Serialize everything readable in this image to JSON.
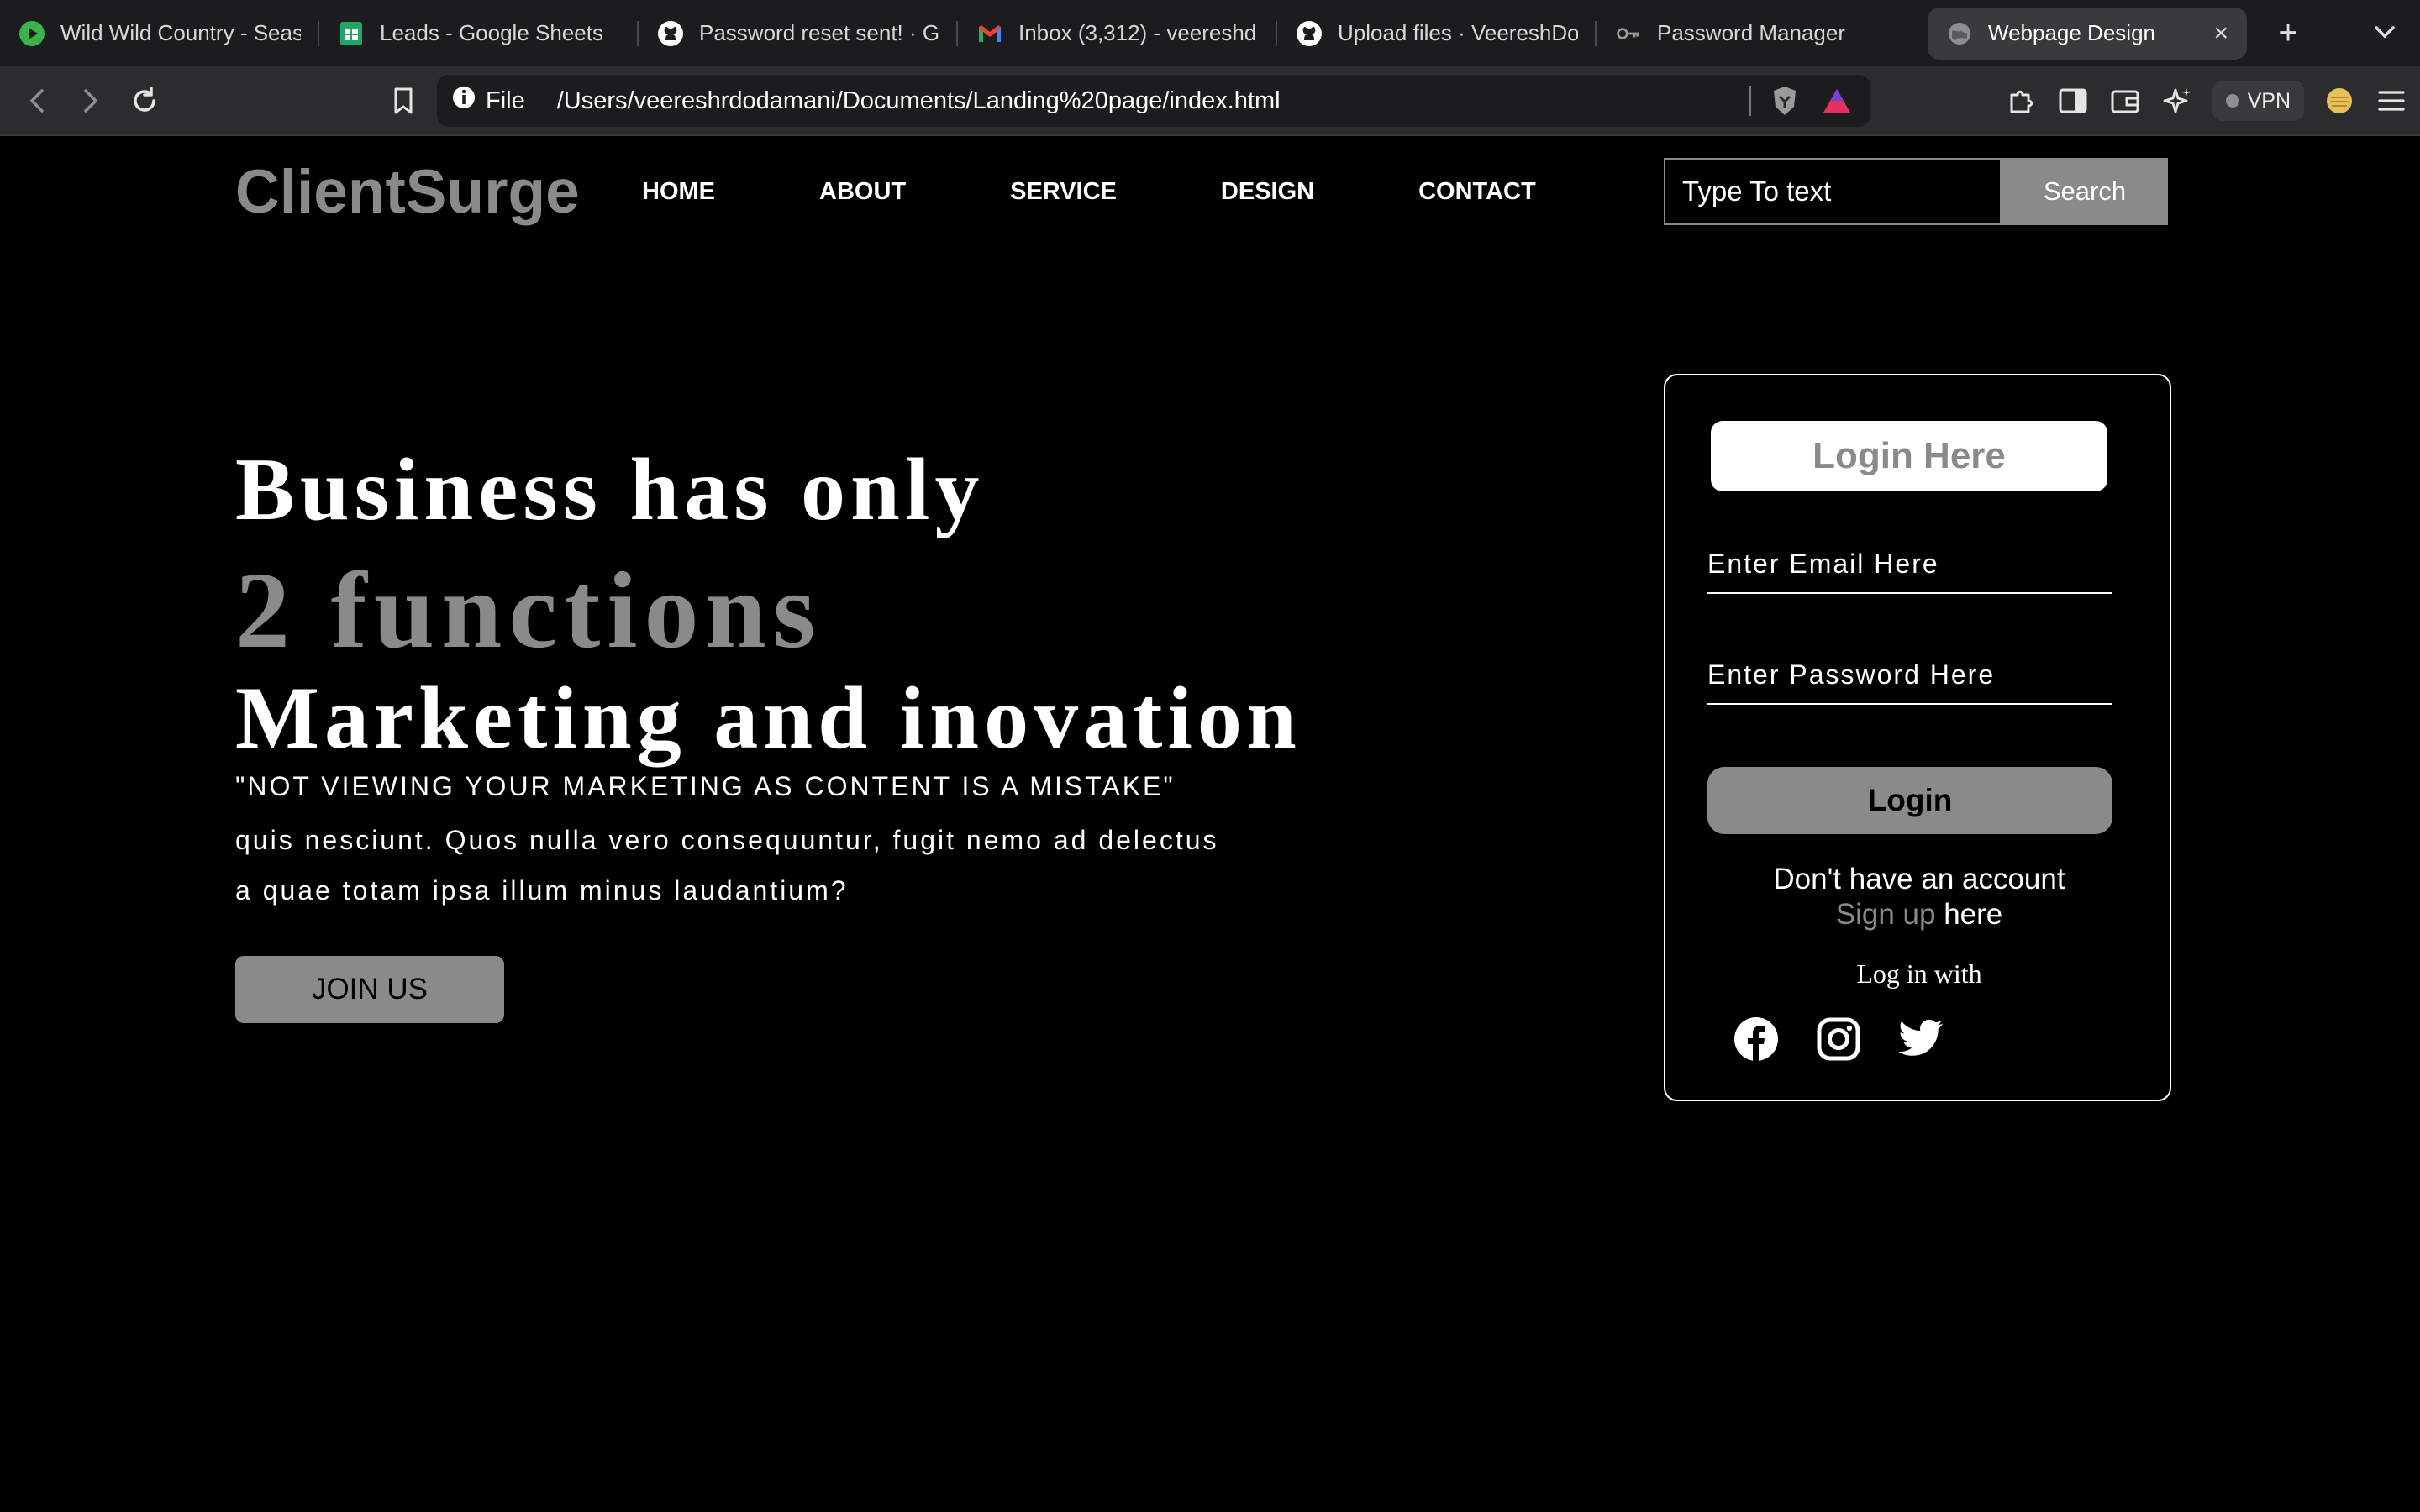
{
  "browser": {
    "tabs": [
      {
        "title": "Wild Wild Country - Seas",
        "icon": "play-icon"
      },
      {
        "title": "Leads - Google Sheets",
        "icon": "sheets-icon"
      },
      {
        "title": "Password reset sent! · Gi",
        "icon": "github-icon"
      },
      {
        "title": "Inbox (3,312) - veereshd",
        "icon": "gmail-icon"
      },
      {
        "title": "Upload files · VeereshDo",
        "icon": "github-icon"
      },
      {
        "title": "Password Manager",
        "icon": "key-icon"
      },
      {
        "title": "Webpage Design",
        "icon": "globe-icon",
        "active": true
      }
    ],
    "address": {
      "scheme_label": "File",
      "url": "/Users/veereshrdodamani/Documents/Landing%20page/index.html"
    },
    "vpn_label": "VPN"
  },
  "site": {
    "logo": "ClientSurge",
    "nav": [
      "HOME",
      "ABOUT",
      "SERVICE",
      "DESIGN",
      "CONTACT"
    ],
    "search": {
      "placeholder": "Type To text",
      "button": "Search"
    }
  },
  "hero": {
    "line1": "Business has only",
    "line2": "2 functions",
    "line3": "Marketing and inovation",
    "quote": "\"NOT VIEWING YOUR MARKETING AS CONTENT IS A MISTAKE\"",
    "desc_line1": "quis nesciunt. Quos nulla vero consequuntur, fugit nemo ad delectus",
    "desc_line2": "a quae totam ipsa illum minus laudantium?",
    "cta": "JOIN US"
  },
  "login": {
    "title": "Login Here",
    "email_placeholder": "Enter Email Here",
    "password_placeholder": "Enter Password Here",
    "button": "Login",
    "no_account": "Don't have an account",
    "signup_link": "Sign up",
    "signup_here": "here",
    "login_with": "Log in with",
    "socials": [
      "facebook-icon",
      "instagram-icon",
      "twitter-icon"
    ]
  },
  "colors": {
    "accent_gray": "#8a8a8a",
    "background": "#000000",
    "text": "#ffffff"
  }
}
